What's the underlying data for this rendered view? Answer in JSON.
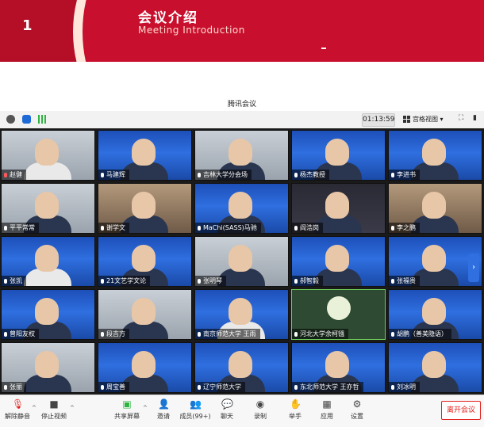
{
  "slide": {
    "number": "1",
    "title": "会议介绍",
    "subtitle": "Meeting Introduction",
    "accent": "#c8102e"
  },
  "app": {
    "title": "腾讯会议"
  },
  "topbar": {
    "timer": "01:13:59",
    "view_label": "宫格视图"
  },
  "participants": [
    {
      "name": "赵健",
      "mic": "muted"
    },
    {
      "name": "马建辉",
      "mic": "on"
    },
    {
      "name": "吉林大学分会场",
      "mic": "on"
    },
    {
      "name": "杨杰教授",
      "mic": "on"
    },
    {
      "name": "李进书",
      "mic": "on"
    },
    {
      "name": "平平常常",
      "mic": "on"
    },
    {
      "name": "谢学文",
      "mic": "on"
    },
    {
      "name": "MaChi(SASS)马驰",
      "mic": "on"
    },
    {
      "name": "阎浩岗",
      "mic": "on"
    },
    {
      "name": "李之鹏",
      "mic": "on"
    },
    {
      "name": "张凯",
      "mic": "on"
    },
    {
      "name": "21文艺学文论",
      "mic": "on"
    },
    {
      "name": "张明琴",
      "mic": "on"
    },
    {
      "name": "郝智毅",
      "mic": "on"
    },
    {
      "name": "张福贵",
      "mic": "on"
    },
    {
      "name": "曾阳友权",
      "mic": "on"
    },
    {
      "name": "段吉方",
      "mic": "on"
    },
    {
      "name": "南京师范大学 王雨",
      "mic": "on"
    },
    {
      "name": "河北大学余柯镪",
      "mic": "on"
    },
    {
      "name": "胡鹏（善美隐语）",
      "mic": "on"
    },
    {
      "name": "张丽",
      "mic": "on"
    },
    {
      "name": "周宝善",
      "mic": "on"
    },
    {
      "name": "辽宁师范大学",
      "mic": "on"
    },
    {
      "name": "东北师范大学 王亦哲",
      "mic": "on"
    },
    {
      "name": "刘冰明",
      "mic": "on"
    }
  ],
  "toolbar": {
    "unmute": "解除静音",
    "stop_video": "停止视频",
    "share": "共享屏幕",
    "invite": "邀请",
    "members": "成员(99+)",
    "chat": "聊天",
    "record": "录制",
    "raise_hand": "举手",
    "apps": "应用",
    "settings": "设置",
    "leave": "离开会议"
  }
}
